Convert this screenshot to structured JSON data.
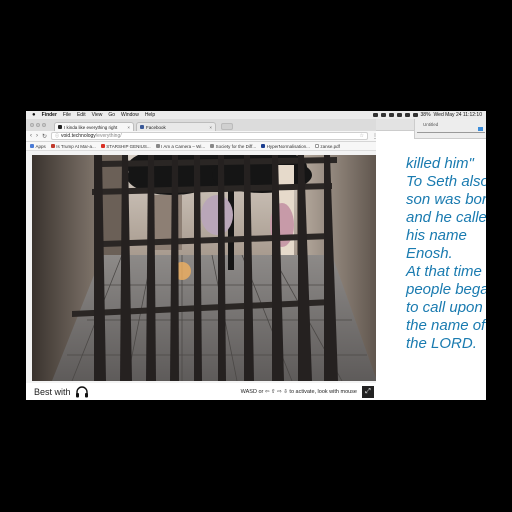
{
  "menubar": {
    "apple": "",
    "app": "Finder",
    "items": [
      "File",
      "Edit",
      "View",
      "Go",
      "Window",
      "Help"
    ],
    "battery": "38%",
    "clock": "Wed May 24  11:12:10"
  },
  "browser": {
    "tabs": [
      {
        "label": "I kinda like everything right",
        "close": "×"
      },
      {
        "label": "Facebook",
        "close": "×"
      }
    ],
    "url": {
      "host": "void.technology",
      "path": "/everything/"
    },
    "bookmarks": [
      {
        "label": "Apps",
        "color": "#4a7bd6"
      },
      {
        "label": "Is Trump At Mar-a...",
        "color": "#c0392b"
      },
      {
        "label": "STARSHIP GENIUS...",
        "color": "#d93025"
      },
      {
        "label": "I Am a Camera – Wi...",
        "color": "#888888"
      },
      {
        "label": "Society for the Diff...",
        "color": "#888888"
      },
      {
        "label": "HyperNormalisation...",
        "color": "#1a3d8f"
      },
      {
        "label": "zanse.pdf",
        "color": "#ffffff"
      }
    ],
    "footer": {
      "best_with": "Best with",
      "headphones_icon": "headphones-icon",
      "hint": "WASD or ⇦ ⇧ ⇨ ⇩ to activate, look with mouse",
      "fullscreen_icon": "fullscreen-icon"
    }
  },
  "textwin": {
    "title": "Untitled",
    "poem_lines": [
      "killed him\"",
      "To Seth also a",
      "son was born,",
      "and he called",
      "his name",
      "Enosh.",
      "At that time",
      "people began",
      "to call upon",
      "the name of",
      "the LORD."
    ],
    "text_color": "#1a7bb0"
  }
}
